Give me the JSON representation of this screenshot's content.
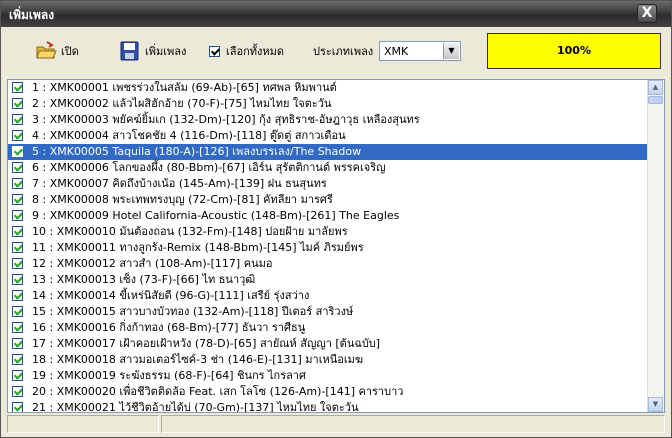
{
  "window": {
    "title": "เพิ่มเพลง",
    "close_label": "X"
  },
  "toolbar": {
    "open_label": "เปิด",
    "add_label": "เพิ่มเพลง",
    "select_all_label": "เลือกทั้งหมด",
    "select_all_checked": true,
    "type_label": "ประเภทเพลง",
    "type_value": "XMK",
    "progress_text": "100%",
    "progress_value": 1.0,
    "progress_color": "#ffff00"
  },
  "list": {
    "selected_index": 4,
    "selected_color": "#316ac5",
    "rows": [
      "1 : XMK00001 เพชรร่วงในสลัม  (69-Ab)-[65] ทศพล หิมพานต์",
      "2 : XMK00002 แล้วไผสิฮักอ้าย (70-F)-[75] ไหมไทย ใจตะวัน",
      "3 : XMK00003 พยัคฆ์ยิ้มเก (132-Dm)-[120] กุ้ง สุทธิราช-อัษฎาวุธ เหลืองสุนทร",
      "4 : XMK00004 สาวโชคชัย 4  (116-Dm)-[118] ตู๊ดตู่ สกาวเดือน",
      "5 : XMK00005 Taquila (180-A)-[126] เพลงบรรเลง/The Shadow",
      "6 : XMK00006 โลกของผึ้ง (80-Bbm)-[67] เอิร์น สุรัตติกานต์ พรรคเจริญ",
      "7 : XMK00007 คิดถึงบ้างเน้อ  (145-Am)-[139] ฝน ธนสุนทร",
      "8 : XMK00008 พระเทพทรงบุญ (72-Cm)-[81] คัทลียา มารศรี",
      "9 : XMK00009 Hotel California-Acoustic (148-Bm)-[261] The Eagles",
      "10 : XMK00010 มันต้องถอน (132-Fm)-[148] ปอยฝ้าย มาลัยพร",
      "11 : XMK00011 ทางลูกรัง-Remix (148-Bbm)-[145] ไมค์ ภิรมย์พร",
      "12 : XMK00012 สาวสำ  (108-Am)-[117] คนมอ",
      "13 : XMK00013 เซ็ง   (73-F)-[66] ไท ธนาวุฒิ",
      "14 : XMK00014 ขี้เหร่นิสัยดี  (96-G)-[111] เสรีย์ รุ่งสว่าง",
      "15 : XMK00015 สาวบางบัวทอง  (132-Am)-[118] ปีเตอร์ สาริวงษ์",
      "16 : XMK00016 กิ่งก้าทอง (68-Bm)-[77] ธันวา ราศีธนู",
      "17 : XMK00017 เฝ้าคอยเฝ้าหวัง  (78-D)-[65] สายัณห์  สัญญา [ต้นฉบับ]",
      "18 : XMK00018 สาวมอเตอร์ไซค์-3 ช่า (146-E)-[131] มาเหนือเมฆ",
      "19 : XMK00019 ระฆังธรรม   (68-F)-[64] ชินกร  ไกรลาศ",
      "20 : XMK00020 เพื่อชีวิตติดล้อ Feat. เสก โลโซ (126-Am)-[141] คาราบาว",
      "21 : XMK00021 ไว้ชีวิตอ้ายได้บ่ (70-Gm)-[137] ไหมไทย ใจตะวัน"
    ]
  }
}
